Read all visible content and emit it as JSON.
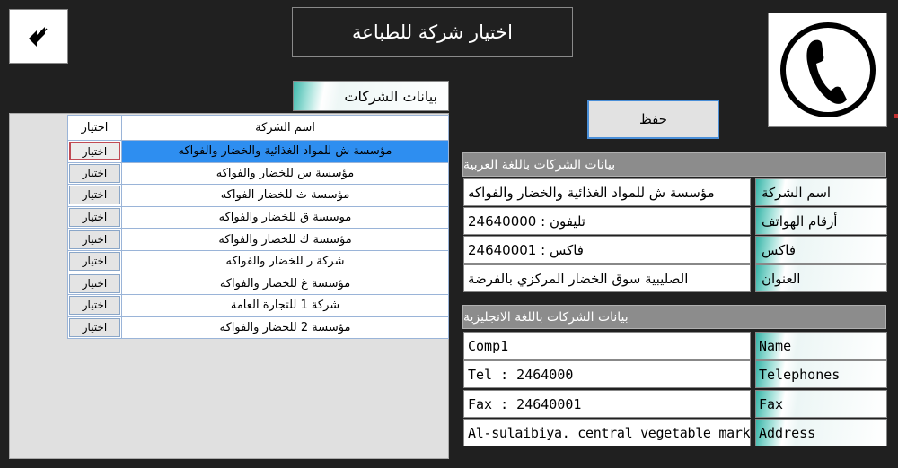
{
  "header": {
    "title": "اختيار شركة للطباعة",
    "back_icon": "back-arrow-icon",
    "phone_icon": "phone-icon"
  },
  "companies_tab": {
    "label": "بيانات الشركات"
  },
  "grid": {
    "columns": {
      "name": "اسم الشركة",
      "select": "اختيار"
    },
    "rows": [
      {
        "name": "مؤسسة ش للمواد الغذائية والخضار والفواكه",
        "select": "اختيار"
      },
      {
        "name": "مؤسسة س للخضار والفواكه",
        "select": "اختيار"
      },
      {
        "name": "مؤسسة ث للخضار الفواكه",
        "select": "اختيار"
      },
      {
        "name": "موسسة ق للخضار والفواكه",
        "select": "اختيار"
      },
      {
        "name": "مؤسسة  ك للخضار والفواكه",
        "select": "اختيار"
      },
      {
        "name": "شركة ر للخضار والفواكه",
        "select": "اختيار"
      },
      {
        "name": "مؤسسة غ للخضار والفواكه",
        "select": "اختيار"
      },
      {
        "name": "شركة 1 للتجارة العامة",
        "select": "اختيار"
      },
      {
        "name": "مؤسسة 2 للخضار والفواكه",
        "select": "اختيار"
      }
    ]
  },
  "save_label": "حفظ",
  "arabic": {
    "header": "بيانات الشركات باللغة العربية",
    "name_label": "اسم الشركة",
    "name_value": "مؤسسة ش للمواد الغذائية والخضار والفواكه",
    "phones_label": "أرقام الهواتف",
    "phones_value": "تليفون : 24640000",
    "fax_label": "فاكس",
    "fax_value": "فاكس : 24640001",
    "address_label": "العنوان",
    "address_value": "الصليبية سوق الخضار المركزي بالفرضة"
  },
  "english": {
    "header": "بيانات الشركات باللغة الانجليزية",
    "name_label": "Name",
    "name_value": "Comp1",
    "phones_label": "Telephones",
    "phones_value": "Tel : 2464000",
    "fax_label": "Fax",
    "fax_value": "Fax : 24640001",
    "address_label": "Address",
    "address_value": "Al-sulaibiya. central vegetable market"
  },
  "colors": {
    "background": "#202020",
    "selected_row": "#2e8ef0",
    "section_header": "#8c8c8c",
    "label_gradient": "#37b4a8"
  }
}
